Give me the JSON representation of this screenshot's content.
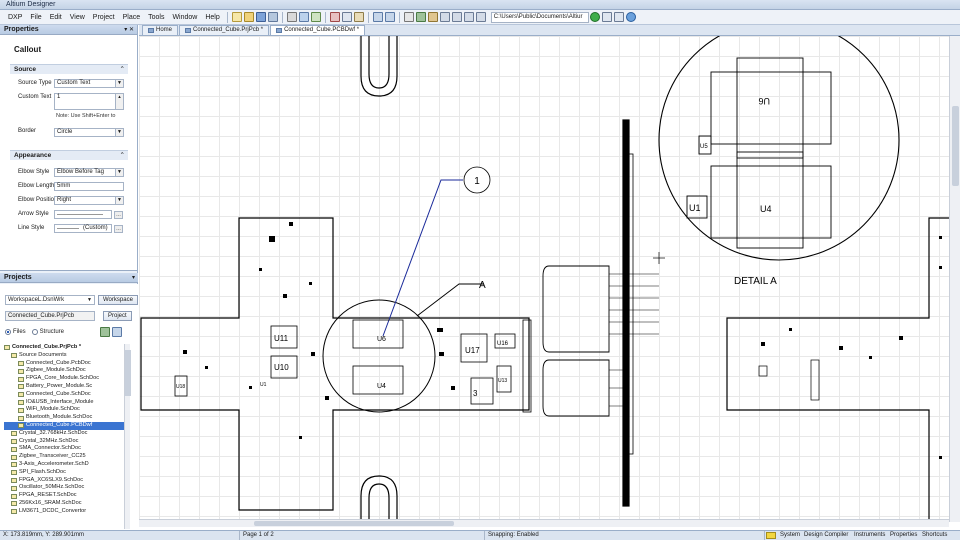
{
  "app": {
    "title": "Altium Designer"
  },
  "menu": [
    {
      "label": "DXP"
    },
    {
      "label": "File"
    },
    {
      "label": "Edit"
    },
    {
      "label": "View"
    },
    {
      "label": "Project"
    },
    {
      "label": "Place"
    },
    {
      "label": "Tools"
    },
    {
      "label": "Window"
    },
    {
      "label": "Help"
    }
  ],
  "toolbar": {
    "path": "C:\\Users\\Public\\Documents\\Altiur"
  },
  "tabs": [
    {
      "label": "Home"
    },
    {
      "label": "Connected_Cube.PrjPcb *"
    },
    {
      "label": "Connected_Cube.PCBDwf *"
    }
  ],
  "properties": {
    "panel_title": "Properties",
    "header": "Callout",
    "source_group": "Source",
    "source_type_label": "Source Type",
    "source_type_value": "Custom Text",
    "custom_text_label": "Custom Text",
    "custom_text_value": "1",
    "note": "Note: Use Shift+Enter to",
    "border_label": "Border",
    "border_value": "Circle",
    "appearance_group": "Appearance",
    "elbow_style_label": "Elbow Style",
    "elbow_style_value": "Elbow Before Tag",
    "elbow_length_label": "Elbow Length",
    "elbow_length_value": "5mm",
    "elbow_position_label": "Elbow Position",
    "elbow_position_value": "Right",
    "arrow_style_label": "Arrow Style",
    "line_style_label": "Line Style",
    "line_style_value": "(Custom)"
  },
  "projects": {
    "panel_title": "Projects",
    "workspace_value": "WorkspaceL.DsnWrk",
    "workspace_button": "Workspace",
    "project_value": "Connected_Cube.PrjPcb",
    "project_button": "Project",
    "files_label": "Files",
    "structure_label": "Structure",
    "tree": [
      {
        "label": "Connected_Cube.PrjPcb *",
        "indent": 0,
        "bold": true,
        "selected": false
      },
      {
        "label": "Source Documents",
        "indent": 1,
        "bold": false,
        "selected": false
      },
      {
        "label": "Connected_Cube.PcbDoc",
        "indent": 2,
        "bold": false,
        "selected": false
      },
      {
        "label": "Zigbee_Module.SchDoc",
        "indent": 2,
        "bold": false,
        "selected": false
      },
      {
        "label": "FPGA_Core_Module.SchDoc",
        "indent": 2,
        "bold": false,
        "selected": false
      },
      {
        "label": "Battery_Power_Module.Sc",
        "indent": 2,
        "bold": false,
        "selected": false
      },
      {
        "label": "Connected_Cube.SchDoc",
        "indent": 2,
        "bold": false,
        "selected": false
      },
      {
        "label": "IO&USB_Interface_Module",
        "indent": 2,
        "bold": false,
        "selected": false
      },
      {
        "label": "WiFi_Module.SchDoc",
        "indent": 2,
        "bold": false,
        "selected": false
      },
      {
        "label": "Bluetooth_Module.SchDoc",
        "indent": 2,
        "bold": false,
        "selected": false
      },
      {
        "label": "Connected_Cube.PCBDwf",
        "indent": 2,
        "bold": false,
        "selected": true
      },
      {
        "label": "Crystal_32.768kHz.SchDoc",
        "indent": 1,
        "bold": false,
        "selected": false
      },
      {
        "label": "Crystal_32MHz.SchDoc",
        "indent": 1,
        "bold": false,
        "selected": false
      },
      {
        "label": "SMA_Connector.SchDoc",
        "indent": 1,
        "bold": false,
        "selected": false
      },
      {
        "label": "Zigbee_Transceiver_CC25",
        "indent": 1,
        "bold": false,
        "selected": false
      },
      {
        "label": "3-Axis_Accelerometer.SchD",
        "indent": 1,
        "bold": false,
        "selected": false
      },
      {
        "label": "SPI_Flash.SchDoc",
        "indent": 1,
        "bold": false,
        "selected": false
      },
      {
        "label": "FPGA_XC6SLX9.SchDoc",
        "indent": 1,
        "bold": false,
        "selected": false
      },
      {
        "label": "Oscillator_50MHz.SchDoc",
        "indent": 1,
        "bold": false,
        "selected": false
      },
      {
        "label": "FPGA_RESET.SchDoc",
        "indent": 1,
        "bold": false,
        "selected": false
      },
      {
        "label": "256Kx16_SRAM.SchDoc",
        "indent": 1,
        "bold": false,
        "selected": false
      },
      {
        "label": "LM3671_DCDC_Convertor",
        "indent": 1,
        "bold": false,
        "selected": false
      }
    ]
  },
  "drawing": {
    "callout_number": "1",
    "view_label": "A",
    "detail_label": "DETAIL A",
    "designators": {
      "u11": "U11",
      "u10": "U10",
      "u6": "U6",
      "u4": "U4",
      "u17": "U17",
      "u16": "U16",
      "u13": "U13",
      "u3": "3",
      "u18": "U18",
      "u1": "U1",
      "u6_detail": "U6",
      "u4_detail": "U4",
      "u1_detail": "U1",
      "u5_detail": "U5"
    }
  },
  "status": {
    "coords": "X: 173.819mm, Y: 289.901mm",
    "page": "Page 1 of 2",
    "snapping": "Snapping: Enabled",
    "links": [
      "System",
      "Design Compiler",
      "Instruments",
      "Properties",
      "Shortcuts"
    ]
  },
  "colors": {
    "accent": "#3a74d1",
    "callout_line": "#1a2a9a",
    "board_outline": "#000000"
  }
}
